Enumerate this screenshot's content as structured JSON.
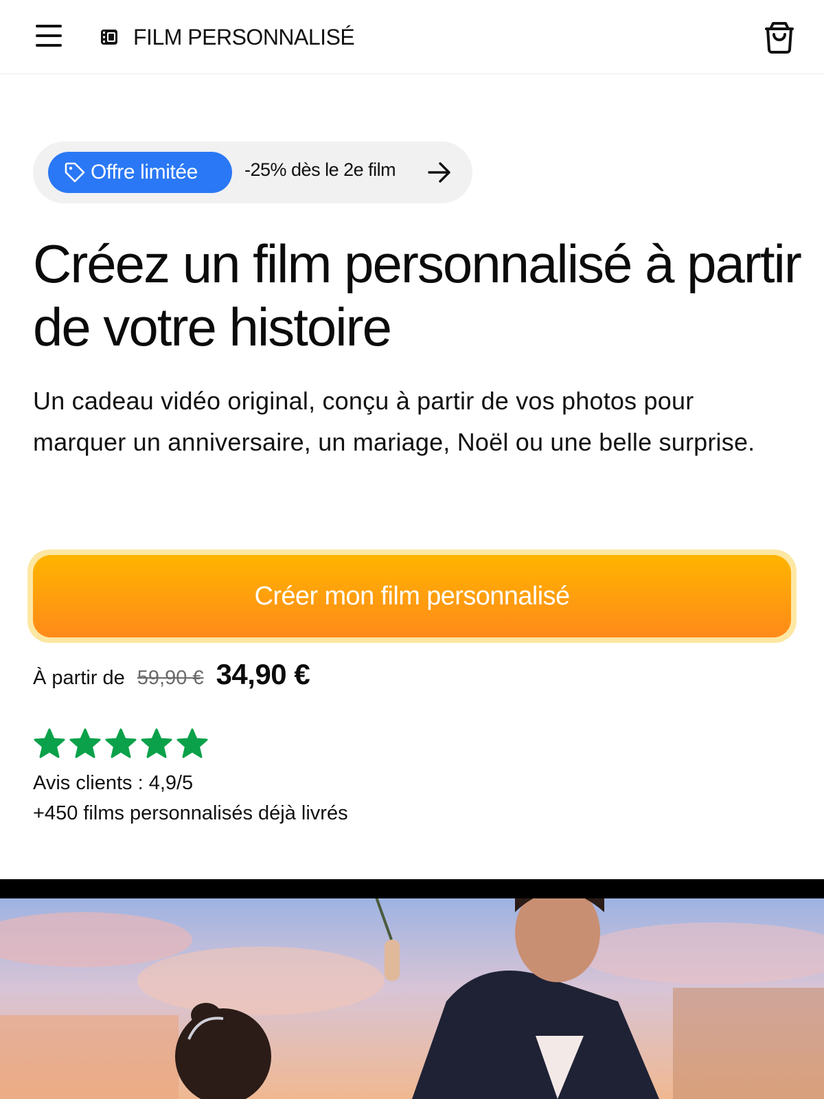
{
  "header": {
    "brand_name": "FILM PERSONNALISÉ",
    "menu_icon": "hamburger-menu-icon",
    "logo_icon": "film-logo-icon",
    "cart_icon": "shopping-bag-icon"
  },
  "promo": {
    "badge_label": "Offre limitée",
    "badge_icon": "tag-icon",
    "text": "-25% dès le 2e film",
    "arrow_icon": "arrow-right-icon",
    "badge_color": "#2a78f5"
  },
  "hero": {
    "title": "Créez un film personnalisé à partir de votre histoire",
    "subtitle": "Un cadeau vidéo original, conçu à partir de vos photos pour marquer un anniversaire, un mariage, Noël ou une belle surprise."
  },
  "cta": {
    "label": "Créer mon film personnalisé",
    "color_top": "#ffb400",
    "color_bottom": "#ff8a1a"
  },
  "price": {
    "prefix": "À partir de",
    "old": "59,90 €",
    "new": "34,90 €"
  },
  "rating": {
    "stars": 5,
    "star_color": "#0aa14a",
    "text": "Avis clients : 4,9/5",
    "delivered": "+450 films personnalisés déjà livrés"
  }
}
